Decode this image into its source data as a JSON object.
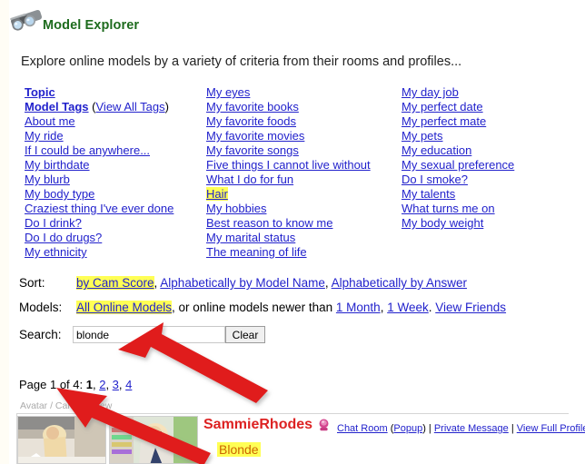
{
  "header": {
    "title": "Model Explorer",
    "icon": "binoculars-icon"
  },
  "intro": "Explore online models by a variety of criteria from their rooms and profiles...",
  "columns": [
    {
      "items": [
        {
          "label": "Topic",
          "bold": true,
          "highlight": false
        },
        {
          "label": "Model Tags",
          "bold": true,
          "highlight": false,
          "suffix_open": " (",
          "suffix_link": "View All Tags",
          "suffix_close": ")"
        },
        {
          "label": "About me",
          "bold": false,
          "highlight": false
        },
        {
          "label": "My ride",
          "bold": false,
          "highlight": false
        },
        {
          "label": "If I could be anywhere...",
          "bold": false,
          "highlight": false
        },
        {
          "label": "My birthdate",
          "bold": false,
          "highlight": false
        },
        {
          "label": "My blurb",
          "bold": false,
          "highlight": false
        },
        {
          "label": "My body type",
          "bold": false,
          "highlight": false
        },
        {
          "label": "Craziest thing I've ever done",
          "bold": false,
          "highlight": false
        },
        {
          "label": "Do I drink?",
          "bold": false,
          "highlight": false
        },
        {
          "label": "Do I do drugs?",
          "bold": false,
          "highlight": false
        },
        {
          "label": "My ethnicity",
          "bold": false,
          "highlight": false
        }
      ]
    },
    {
      "items": [
        {
          "label": "My eyes",
          "bold": false,
          "highlight": false
        },
        {
          "label": "My favorite books",
          "bold": false,
          "highlight": false
        },
        {
          "label": "My favorite foods",
          "bold": false,
          "highlight": false
        },
        {
          "label": "My favorite movies",
          "bold": false,
          "highlight": false
        },
        {
          "label": "My favorite songs",
          "bold": false,
          "highlight": false
        },
        {
          "label": "Five things I cannot live without",
          "bold": false,
          "highlight": false
        },
        {
          "label": "What I do for fun",
          "bold": false,
          "highlight": false
        },
        {
          "label": "Hair",
          "bold": false,
          "highlight": true
        },
        {
          "label": "My hobbies",
          "bold": false,
          "highlight": false
        },
        {
          "label": "Best reason to know me",
          "bold": false,
          "highlight": false
        },
        {
          "label": "My marital status",
          "bold": false,
          "highlight": false
        },
        {
          "label": "The meaning of life",
          "bold": false,
          "highlight": false
        }
      ]
    },
    {
      "items": [
        {
          "label": "My day job",
          "bold": false,
          "highlight": false
        },
        {
          "label": "My perfect date",
          "bold": false,
          "highlight": false
        },
        {
          "label": "My perfect mate",
          "bold": false,
          "highlight": false
        },
        {
          "label": "My pets",
          "bold": false,
          "highlight": false
        },
        {
          "label": "My education",
          "bold": false,
          "highlight": false
        },
        {
          "label": "My sexual preference",
          "bold": false,
          "highlight": false
        },
        {
          "label": "Do I smoke?",
          "bold": false,
          "highlight": false
        },
        {
          "label": "My talents",
          "bold": false,
          "highlight": false
        },
        {
          "label": "What turns me on",
          "bold": false,
          "highlight": false
        },
        {
          "label": "My body weight",
          "bold": false,
          "highlight": false
        }
      ]
    }
  ],
  "sort": {
    "label": "Sort:",
    "options": [
      {
        "label": "by Cam Score",
        "selected": true
      },
      {
        "label": "Alphabetically by Model Name",
        "selected": false
      },
      {
        "label": "Alphabetically by Answer",
        "selected": false
      }
    ]
  },
  "models": {
    "label": "Models:",
    "all_label": "All Online Models",
    "middle_text": ", or online models newer than ",
    "newer_1": "1 Month",
    "newer_sep": ", ",
    "newer_2": "1 Week",
    "tail_sep": ". ",
    "friends_label": "View Friends"
  },
  "search": {
    "label": "Search:",
    "value": "blonde",
    "placeholder": "",
    "clear_label": "Clear"
  },
  "pagination": {
    "text": "Page 1 of 4:",
    "pages": [
      {
        "label": "1",
        "current": true
      },
      {
        "label": "2",
        "current": false
      },
      {
        "label": "3",
        "current": false
      },
      {
        "label": "4",
        "current": false
      }
    ]
  },
  "results": {
    "column_header": "Avatar / Cam Preview",
    "rows": [
      {
        "name": "SammieRhodes",
        "gender_icon": "female-symbol-icon",
        "links": [
          {
            "label": "Chat Room",
            "link": true
          },
          {
            "label": "(",
            "link": false
          },
          {
            "label": "Popup",
            "link": true
          },
          {
            "label": ") | ",
            "link": false
          },
          {
            "label": "Private Message",
            "link": true
          },
          {
            "label": " | ",
            "link": false
          },
          {
            "label": "View Full Profile",
            "link": true
          }
        ],
        "answer": "Blonde"
      }
    ]
  },
  "annotations": {
    "arrow_color": "#e01b1b",
    "arrows": [
      {
        "name": "arrow-to-search-field",
        "points_to": "search-input"
      },
      {
        "name": "arrow-to-answer",
        "points_to": "model-answer"
      }
    ]
  },
  "colors": {
    "title_green": "#1d6b1d",
    "link_blue": "#2222cc",
    "highlight_yellow": "#ffff55",
    "model_name_red": "#dd2222",
    "answer_orange": "#cc6600"
  }
}
